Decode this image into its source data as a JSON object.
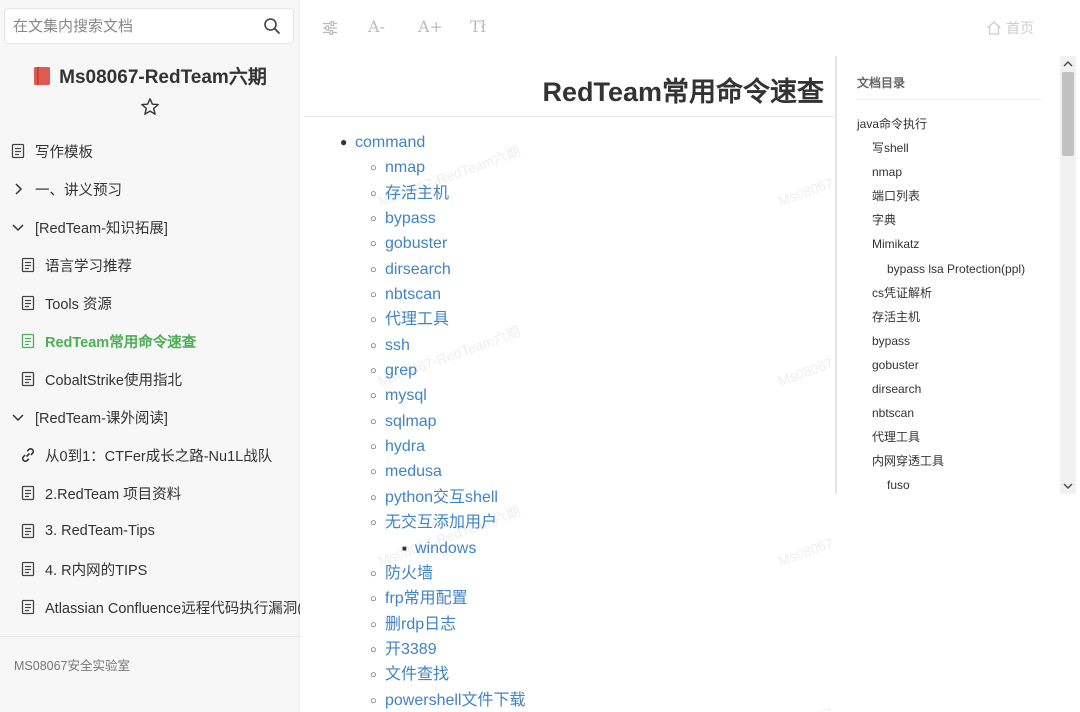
{
  "search": {
    "placeholder": "在文集内搜索文档"
  },
  "book": {
    "title": "Ms08067-RedTeam六期"
  },
  "sidebar": {
    "items": [
      {
        "label": "写作模板",
        "level": 0,
        "icon": "doc-icon",
        "active": false
      },
      {
        "label": "一、讲义预习",
        "level": 0,
        "icon": "chevron-right-icon",
        "active": false
      },
      {
        "label": "[RedTeam-知识拓展]",
        "level": 0,
        "icon": "chevron-down-icon",
        "active": false
      },
      {
        "label": "语言学习推荐",
        "level": 1,
        "icon": "doc-icon",
        "active": false
      },
      {
        "label": "Tools 资源",
        "level": 1,
        "icon": "doc-icon",
        "active": false
      },
      {
        "label": "RedTeam常用命令速查",
        "level": 1,
        "icon": "doc-icon",
        "active": true
      },
      {
        "label": "CobaltStrike使用指北",
        "level": 1,
        "icon": "doc-icon",
        "active": false
      },
      {
        "label": "[RedTeam-课外阅读]",
        "level": 0,
        "icon": "chevron-down-icon",
        "active": false
      },
      {
        "label": "从0到1：CTFer成长之路-Nu1L战队",
        "level": 1,
        "icon": "link-icon",
        "active": false
      },
      {
        "label": "2.RedTeam 项目资料",
        "level": 1,
        "icon": "doc-icon",
        "active": false
      },
      {
        "label": "3. RedTeam-Tips",
        "level": 1,
        "icon": "doc-icon",
        "active": false
      },
      {
        "label": "4. R内网的TIPS",
        "level": 1,
        "icon": "doc-icon",
        "active": false
      },
      {
        "label": "Atlassian Confluence远程代码执行漏洞(C",
        "level": 1,
        "icon": "doc-icon",
        "active": false
      }
    ],
    "footer": "MS08067安全实验室"
  },
  "toolbar": {
    "settings_icon": "sliders-icon",
    "font_decrease": "A-",
    "font_increase": "A+",
    "font_toggle": "Tł",
    "home_label": "首页"
  },
  "article": {
    "title": "RedTeam常用命令速查",
    "list": [
      {
        "text": "command",
        "level": 1
      },
      {
        "text": "nmap",
        "level": 2
      },
      {
        "text": "存活主机",
        "level": 2
      },
      {
        "text": "bypass",
        "level": 2
      },
      {
        "text": "gobuster",
        "level": 2
      },
      {
        "text": "dirsearch",
        "level": 2
      },
      {
        "text": "nbtscan",
        "level": 2
      },
      {
        "text": "代理工具",
        "level": 2
      },
      {
        "text": "ssh",
        "level": 2
      },
      {
        "text": "grep",
        "level": 2
      },
      {
        "text": "mysql",
        "level": 2
      },
      {
        "text": "sqlmap",
        "level": 2
      },
      {
        "text": "hydra",
        "level": 2
      },
      {
        "text": "medusa",
        "level": 2
      },
      {
        "text": "python交互shell",
        "level": 2
      },
      {
        "text": "无交互添加用户",
        "level": 2
      },
      {
        "text": "windows",
        "level": 3
      },
      {
        "text": "防火墙",
        "level": 2
      },
      {
        "text": "frp常用配置",
        "level": 2
      },
      {
        "text": "删rdp日志",
        "level": 2
      },
      {
        "text": "开3389",
        "level": 2
      },
      {
        "text": "文件查找",
        "level": 2
      },
      {
        "text": "powershell文件下载",
        "level": 2
      }
    ],
    "watermark": "Ms08067-RedTeam六期"
  },
  "toc": {
    "title": "文档目录",
    "items": [
      {
        "text": "java命令执行",
        "level": 0
      },
      {
        "text": "写shell",
        "level": 1
      },
      {
        "text": "nmap",
        "level": 1
      },
      {
        "text": "端口列表",
        "level": 1
      },
      {
        "text": "字典",
        "level": 1
      },
      {
        "text": "Mimikatz",
        "level": 1
      },
      {
        "text": "bypass lsa Protection(ppl)",
        "level": 2
      },
      {
        "text": "cs凭证解析",
        "level": 1
      },
      {
        "text": "存活主机",
        "level": 1
      },
      {
        "text": "bypass",
        "level": 1
      },
      {
        "text": "gobuster",
        "level": 1
      },
      {
        "text": "dirsearch",
        "level": 1
      },
      {
        "text": "nbtscan",
        "level": 1
      },
      {
        "text": "代理工具",
        "level": 1
      },
      {
        "text": "内网穿透工具",
        "level": 1
      },
      {
        "text": "fuso",
        "level": 2
      }
    ]
  },
  "colors": {
    "accent_green": "#4cae57",
    "link_blue": "#4183c4"
  }
}
